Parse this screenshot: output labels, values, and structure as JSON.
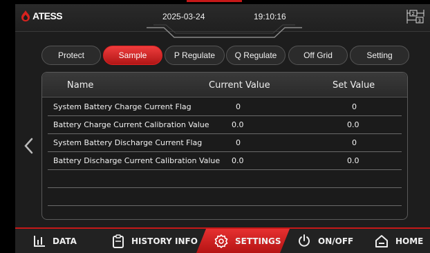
{
  "header": {
    "brand": "ATESS",
    "date": "2025-03-24",
    "time": "19:10:16"
  },
  "tabs": [
    {
      "label": "Protect",
      "active": false
    },
    {
      "label": "Sample",
      "active": true
    },
    {
      "label": "P Regulate",
      "active": false
    },
    {
      "label": "Q Regulate",
      "active": false
    },
    {
      "label": "Off Grid",
      "active": false
    },
    {
      "label": "Setting",
      "active": false
    }
  ],
  "table": {
    "columns": [
      "Name",
      "Current Value",
      "Set Value"
    ],
    "rows": [
      {
        "name": "System Battery Charge Current Flag",
        "current": "0",
        "set": "0"
      },
      {
        "name": "Battery Charge Current Calibration Value",
        "current": "0.0",
        "set": "0.0"
      },
      {
        "name": "System Battery Discharge Current Flag",
        "current": "0",
        "set": "0"
      },
      {
        "name": "Battery Discharge Current Calibration Value",
        "current": "0.0",
        "set": "0.0"
      }
    ]
  },
  "bottom_nav": [
    {
      "label": "DATA",
      "icon": "bar-chart-icon",
      "active": false
    },
    {
      "label": "HISTORY INFO",
      "icon": "clipboard-icon",
      "active": false
    },
    {
      "label": "SETTINGS",
      "icon": "gear-icon",
      "active": true
    },
    {
      "label": "ON/OFF",
      "icon": "power-icon",
      "active": false
    },
    {
      "label": "HOME",
      "icon": "home-icon",
      "active": false
    }
  ],
  "colors": {
    "accent": "#c61818",
    "background": "#1d1d1d",
    "text": "#f0f0f0"
  }
}
